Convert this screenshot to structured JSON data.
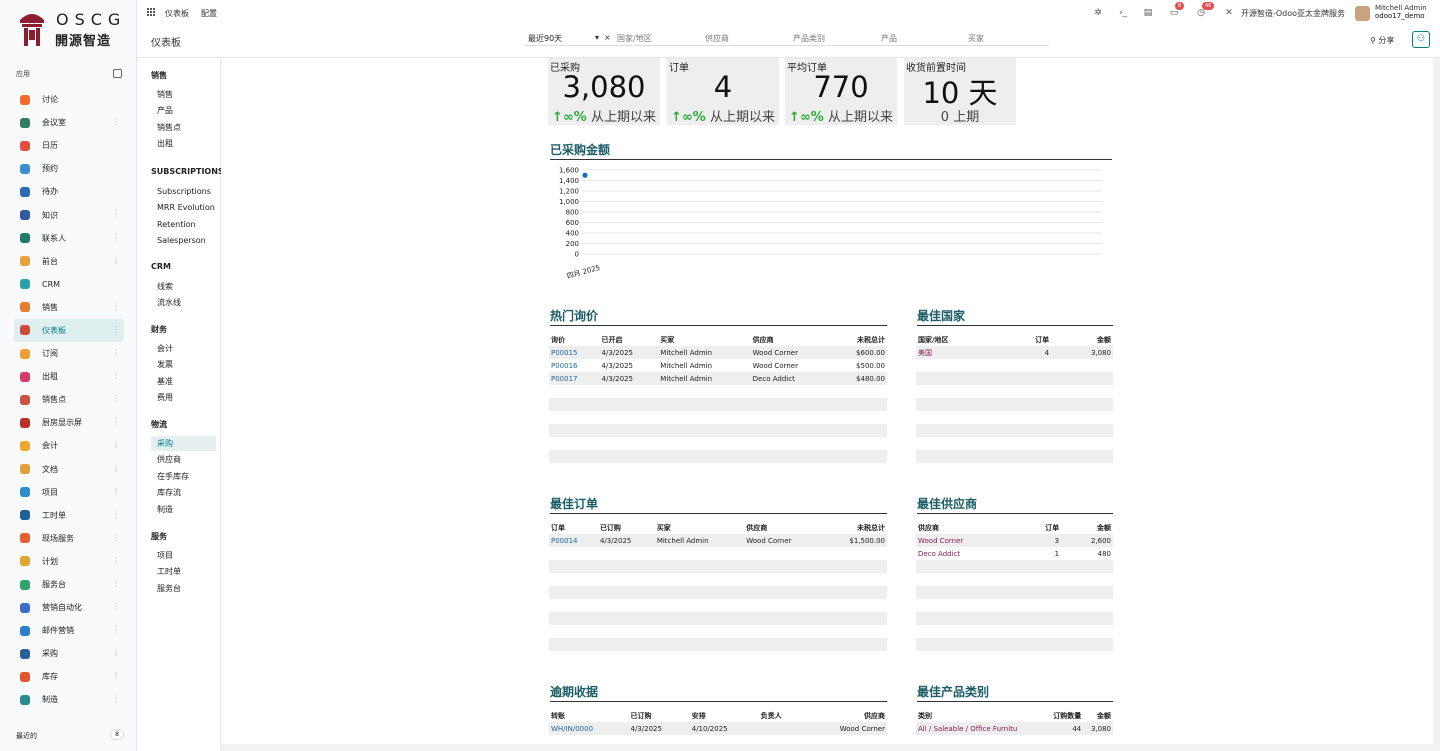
{
  "brand": {
    "en": "OSCG",
    "cn": "開源智造"
  },
  "sidebar": {
    "apps_label": "应用",
    "recent_label": "最近的",
    "recent_count": "8",
    "items": [
      {
        "label": "讨论",
        "color": "#f06b2a"
      },
      {
        "label": "会议室",
        "color": "#2f7d5c"
      },
      {
        "label": "日历",
        "color": "#e54d3d"
      },
      {
        "label": "预约",
        "color": "#3a8fd0"
      },
      {
        "label": "待办",
        "color": "#2b6cb0"
      },
      {
        "label": "知识",
        "color": "#2d5aa0"
      },
      {
        "label": "联系人",
        "color": "#1f7a6a"
      },
      {
        "label": "前台",
        "color": "#e6a23c"
      },
      {
        "label": "CRM",
        "color": "#2aa1a8"
      },
      {
        "label": "销售",
        "color": "#e57b2f"
      },
      {
        "label": "仪表板",
        "color": "#d04a3a"
      },
      {
        "label": "订阅",
        "color": "#f0a030"
      },
      {
        "label": "出租",
        "color": "#d63a6a"
      },
      {
        "label": "销售点",
        "color": "#c8553d"
      },
      {
        "label": "厨房显示屏",
        "color": "#b8322a"
      },
      {
        "label": "会计",
        "color": "#f0a830"
      },
      {
        "label": "文档",
        "color": "#e2a13a"
      },
      {
        "label": "项目",
        "color": "#2a8cc8"
      },
      {
        "label": "工时单",
        "color": "#1f5f9a"
      },
      {
        "label": "现场服务",
        "color": "#e5602f"
      },
      {
        "label": "计划",
        "color": "#e0a630"
      },
      {
        "label": "服务台",
        "color": "#2ea36a"
      },
      {
        "label": "营销自动化",
        "color": "#3a6dc4"
      },
      {
        "label": "邮件营销",
        "color": "#2a7fc8"
      },
      {
        "label": "采购",
        "color": "#2a5e9a"
      },
      {
        "label": "库存",
        "color": "#e2532f"
      },
      {
        "label": "制造",
        "color": "#2a8a8e"
      }
    ]
  },
  "topbar": {
    "menu": [
      "仪表板",
      "配置"
    ],
    "badge_msgs": "8",
    "badge_activity": "46",
    "company": "开源智造-Odoo亚太金牌服务",
    "user_name": "Mitchell Admin",
    "user_db": "odoo17_demo"
  },
  "control": {
    "breadcrumb": "仪表板",
    "filter_period": "最近90天",
    "filters": [
      "国家/地区",
      "供应商",
      "产品类别",
      "产品",
      "买家"
    ],
    "share": "分享"
  },
  "dashnav": {
    "sections": [
      {
        "title": "销售",
        "items": [
          "销售",
          "产品",
          "销售点",
          "出租"
        ]
      },
      {
        "title": "SUBSCRIPTIONS",
        "items": [
          "Subscriptions",
          "MRR Evolution",
          "Retention",
          "Salesperson"
        ]
      },
      {
        "title": "CRM",
        "items": [
          "线索",
          "流水线"
        ]
      },
      {
        "title": "财务",
        "items": [
          "会计",
          "发票",
          "基准",
          "费用"
        ]
      },
      {
        "title": "物流",
        "items": [
          "采购",
          "供应商",
          "在手库存",
          "库存流",
          "制造"
        ]
      },
      {
        "title": "服务",
        "items": [
          "项目",
          "工时单",
          "服务台"
        ]
      }
    ]
  },
  "kpis": [
    {
      "title": "已采购",
      "value": "3,080",
      "sub_arrow": "↑∞%",
      "sub": "从上期以来"
    },
    {
      "title": "订单",
      "value": "4",
      "sub_arrow": "↑∞%",
      "sub": "从上期以来"
    },
    {
      "title": "平均订单",
      "value": "770",
      "sub_arrow": "↑∞%",
      "sub": "从上期以来"
    },
    {
      "title": "收货前置时间",
      "value": "10 天",
      "sub_arrow": "",
      "sub": "0 上期"
    }
  ],
  "chart_data": {
    "type": "line",
    "title": "已采购金额",
    "x": [
      "四月 2025"
    ],
    "series": [
      {
        "values": [
          1500
        ]
      }
    ],
    "ylim": [
      0,
      1600
    ],
    "yticks": [
      "1,600",
      "1,400",
      "1,200",
      "1,000",
      "800",
      "600",
      "400",
      "200",
      "0"
    ],
    "grid": true
  },
  "sections": {
    "hot_rfq": {
      "title": "热门询价",
      "headers": [
        "询价",
        "已开启",
        "买家",
        "供应商",
        "未税总计"
      ],
      "rows": [
        [
          "P00015",
          "4/3/2025",
          "Mitchell Admin",
          "Wood Corner",
          "$600.00"
        ],
        [
          "P00016",
          "4/3/2025",
          "Mitchell Admin",
          "Wood Corner",
          "$500.00"
        ],
        [
          "P00017",
          "4/3/2025",
          "Mitchell Admin",
          "Deco Addict",
          "$480.00"
        ]
      ]
    },
    "best_country": {
      "title": "最佳国家",
      "headers": [
        "国家/地区",
        "订单",
        "金额"
      ],
      "rows": [
        [
          "美国",
          "4",
          "3,080"
        ]
      ]
    },
    "best_orders": {
      "title": "最佳订单",
      "headers": [
        "订单",
        "已订购",
        "买家",
        "供应商",
        "未税总计"
      ],
      "rows": [
        [
          "P00014",
          "4/3/2025",
          "Mitchell Admin",
          "Wood Corner",
          "$1,500.00"
        ]
      ]
    },
    "best_vendor": {
      "title": "最佳供应商",
      "headers": [
        "供应商",
        "订单",
        "金额"
      ],
      "rows": [
        [
          "Wood Corner",
          "3",
          "2,600"
        ],
        [
          "Deco Addict",
          "1",
          "480"
        ]
      ]
    },
    "late_receipts": {
      "title": "逾期收据",
      "headers": [
        "转账",
        "已订购",
        "安排",
        "负责人",
        "供应商"
      ],
      "rows": [
        [
          "WH/IN/0000",
          "4/3/2025",
          "4/10/2025",
          "",
          "Wood Corner"
        ]
      ]
    },
    "best_category": {
      "title": "最佳产品类别",
      "headers": [
        "类别",
        "订购数量",
        "金额"
      ],
      "rows": [
        [
          "All / Saleable / Office Furnitu",
          "44",
          "3,080"
        ]
      ]
    }
  }
}
